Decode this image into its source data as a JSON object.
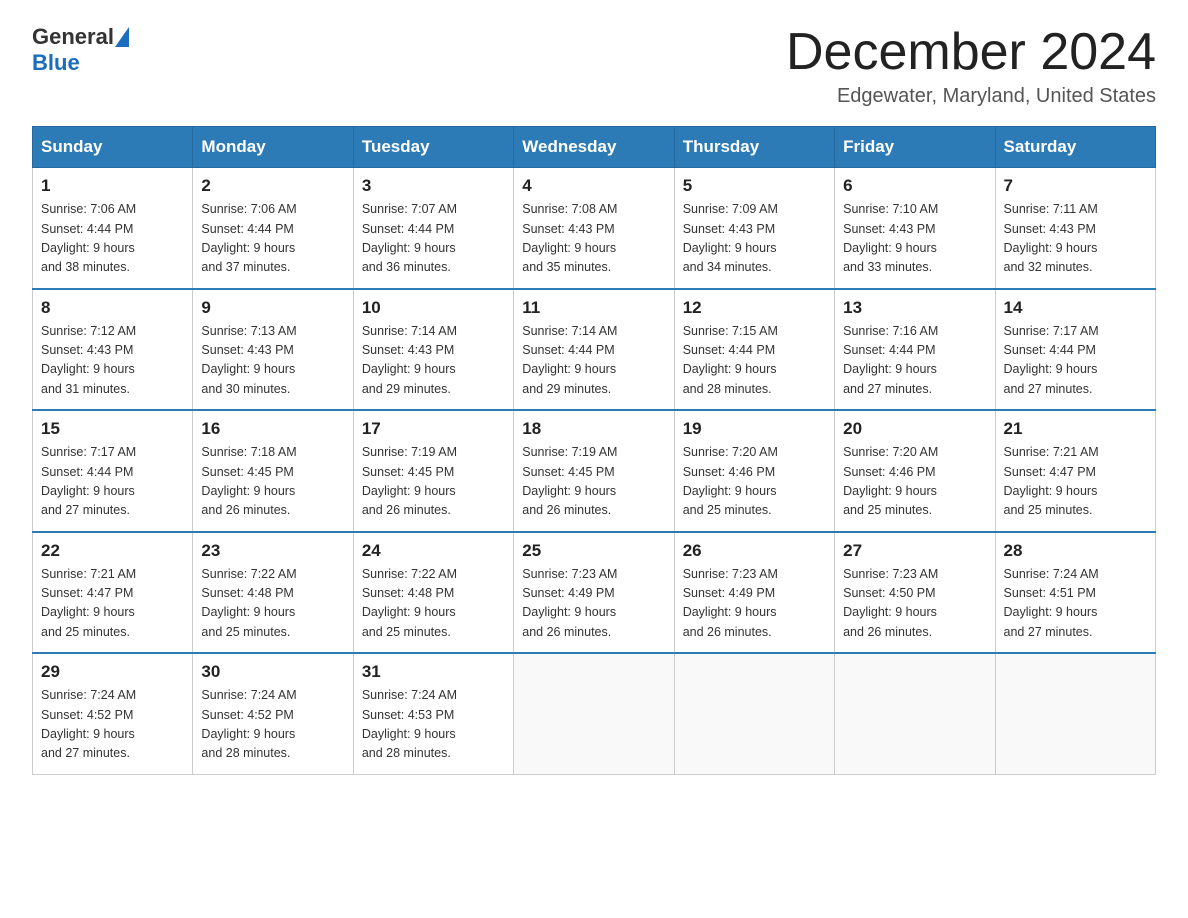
{
  "header": {
    "logo_general": "General",
    "logo_blue": "Blue",
    "calendar_title": "December 2024",
    "calendar_subtitle": "Edgewater, Maryland, United States"
  },
  "days_of_week": [
    "Sunday",
    "Monday",
    "Tuesday",
    "Wednesday",
    "Thursday",
    "Friday",
    "Saturday"
  ],
  "weeks": [
    [
      {
        "day": "1",
        "sunrise": "7:06 AM",
        "sunset": "4:44 PM",
        "daylight_hours": "9",
        "daylight_minutes": "38"
      },
      {
        "day": "2",
        "sunrise": "7:06 AM",
        "sunset": "4:44 PM",
        "daylight_hours": "9",
        "daylight_minutes": "37"
      },
      {
        "day": "3",
        "sunrise": "7:07 AM",
        "sunset": "4:44 PM",
        "daylight_hours": "9",
        "daylight_minutes": "36"
      },
      {
        "day": "4",
        "sunrise": "7:08 AM",
        "sunset": "4:43 PM",
        "daylight_hours": "9",
        "daylight_minutes": "35"
      },
      {
        "day": "5",
        "sunrise": "7:09 AM",
        "sunset": "4:43 PM",
        "daylight_hours": "9",
        "daylight_minutes": "34"
      },
      {
        "day": "6",
        "sunrise": "7:10 AM",
        "sunset": "4:43 PM",
        "daylight_hours": "9",
        "daylight_minutes": "33"
      },
      {
        "day": "7",
        "sunrise": "7:11 AM",
        "sunset": "4:43 PM",
        "daylight_hours": "9",
        "daylight_minutes": "32"
      }
    ],
    [
      {
        "day": "8",
        "sunrise": "7:12 AM",
        "sunset": "4:43 PM",
        "daylight_hours": "9",
        "daylight_minutes": "31"
      },
      {
        "day": "9",
        "sunrise": "7:13 AM",
        "sunset": "4:43 PM",
        "daylight_hours": "9",
        "daylight_minutes": "30"
      },
      {
        "day": "10",
        "sunrise": "7:14 AM",
        "sunset": "4:43 PM",
        "daylight_hours": "9",
        "daylight_minutes": "29"
      },
      {
        "day": "11",
        "sunrise": "7:14 AM",
        "sunset": "4:44 PM",
        "daylight_hours": "9",
        "daylight_minutes": "29"
      },
      {
        "day": "12",
        "sunrise": "7:15 AM",
        "sunset": "4:44 PM",
        "daylight_hours": "9",
        "daylight_minutes": "28"
      },
      {
        "day": "13",
        "sunrise": "7:16 AM",
        "sunset": "4:44 PM",
        "daylight_hours": "9",
        "daylight_minutes": "27"
      },
      {
        "day": "14",
        "sunrise": "7:17 AM",
        "sunset": "4:44 PM",
        "daylight_hours": "9",
        "daylight_minutes": "27"
      }
    ],
    [
      {
        "day": "15",
        "sunrise": "7:17 AM",
        "sunset": "4:44 PM",
        "daylight_hours": "9",
        "daylight_minutes": "27"
      },
      {
        "day": "16",
        "sunrise": "7:18 AM",
        "sunset": "4:45 PM",
        "daylight_hours": "9",
        "daylight_minutes": "26"
      },
      {
        "day": "17",
        "sunrise": "7:19 AM",
        "sunset": "4:45 PM",
        "daylight_hours": "9",
        "daylight_minutes": "26"
      },
      {
        "day": "18",
        "sunrise": "7:19 AM",
        "sunset": "4:45 PM",
        "daylight_hours": "9",
        "daylight_minutes": "26"
      },
      {
        "day": "19",
        "sunrise": "7:20 AM",
        "sunset": "4:46 PM",
        "daylight_hours": "9",
        "daylight_minutes": "25"
      },
      {
        "day": "20",
        "sunrise": "7:20 AM",
        "sunset": "4:46 PM",
        "daylight_hours": "9",
        "daylight_minutes": "25"
      },
      {
        "day": "21",
        "sunrise": "7:21 AM",
        "sunset": "4:47 PM",
        "daylight_hours": "9",
        "daylight_minutes": "25"
      }
    ],
    [
      {
        "day": "22",
        "sunrise": "7:21 AM",
        "sunset": "4:47 PM",
        "daylight_hours": "9",
        "daylight_minutes": "25"
      },
      {
        "day": "23",
        "sunrise": "7:22 AM",
        "sunset": "4:48 PM",
        "daylight_hours": "9",
        "daylight_minutes": "25"
      },
      {
        "day": "24",
        "sunrise": "7:22 AM",
        "sunset": "4:48 PM",
        "daylight_hours": "9",
        "daylight_minutes": "25"
      },
      {
        "day": "25",
        "sunrise": "7:23 AM",
        "sunset": "4:49 PM",
        "daylight_hours": "9",
        "daylight_minutes": "26"
      },
      {
        "day": "26",
        "sunrise": "7:23 AM",
        "sunset": "4:49 PM",
        "daylight_hours": "9",
        "daylight_minutes": "26"
      },
      {
        "day": "27",
        "sunrise": "7:23 AM",
        "sunset": "4:50 PM",
        "daylight_hours": "9",
        "daylight_minutes": "26"
      },
      {
        "day": "28",
        "sunrise": "7:24 AM",
        "sunset": "4:51 PM",
        "daylight_hours": "9",
        "daylight_minutes": "27"
      }
    ],
    [
      {
        "day": "29",
        "sunrise": "7:24 AM",
        "sunset": "4:52 PM",
        "daylight_hours": "9",
        "daylight_minutes": "27"
      },
      {
        "day": "30",
        "sunrise": "7:24 AM",
        "sunset": "4:52 PM",
        "daylight_hours": "9",
        "daylight_minutes": "28"
      },
      {
        "day": "31",
        "sunrise": "7:24 AM",
        "sunset": "4:53 PM",
        "daylight_hours": "9",
        "daylight_minutes": "28"
      },
      null,
      null,
      null,
      null
    ]
  ],
  "labels": {
    "sunrise": "Sunrise:",
    "sunset": "Sunset:",
    "daylight": "Daylight: 9 hours"
  },
  "colors": {
    "header_bg": "#2c7bb6",
    "accent": "#1a6ebd"
  }
}
